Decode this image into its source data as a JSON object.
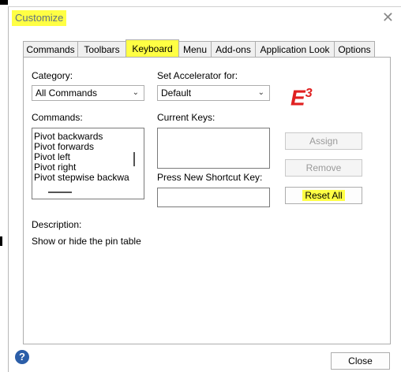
{
  "window": {
    "title": "Customize",
    "close_glyph": "✕"
  },
  "tabs": [
    {
      "label": "Commands"
    },
    {
      "label": "Toolbars"
    },
    {
      "label": "Keyboard",
      "active": true
    },
    {
      "label": "Menu"
    },
    {
      "label": "Add-ons"
    },
    {
      "label": "Application Look"
    },
    {
      "label": "Options"
    }
  ],
  "keyboard": {
    "category_label": "Category:",
    "category_value": "All Commands",
    "set_accel_label": "Set Accelerator for:",
    "set_accel_value": "Default",
    "commands_label": "Commands:",
    "commands": [
      "Pivot backwards",
      "Pivot forwards",
      "Pivot left",
      "Pivot right",
      "Pivot stepwise backwa"
    ],
    "current_keys_label": "Current Keys:",
    "press_new_label": "Press New Shortcut Key:",
    "assign_label": "Assign",
    "remove_label": "Remove",
    "reset_all_label": "Reset All",
    "description_label": "Description:",
    "description_text": "Show or hide the pin table",
    "logo_text": "E",
    "logo_sup": "3"
  },
  "footer": {
    "help_glyph": "?",
    "close_label": "Close"
  },
  "colors": {
    "highlight": "#ffff44",
    "logo": "#e02020",
    "help": "#2b5ea8"
  }
}
